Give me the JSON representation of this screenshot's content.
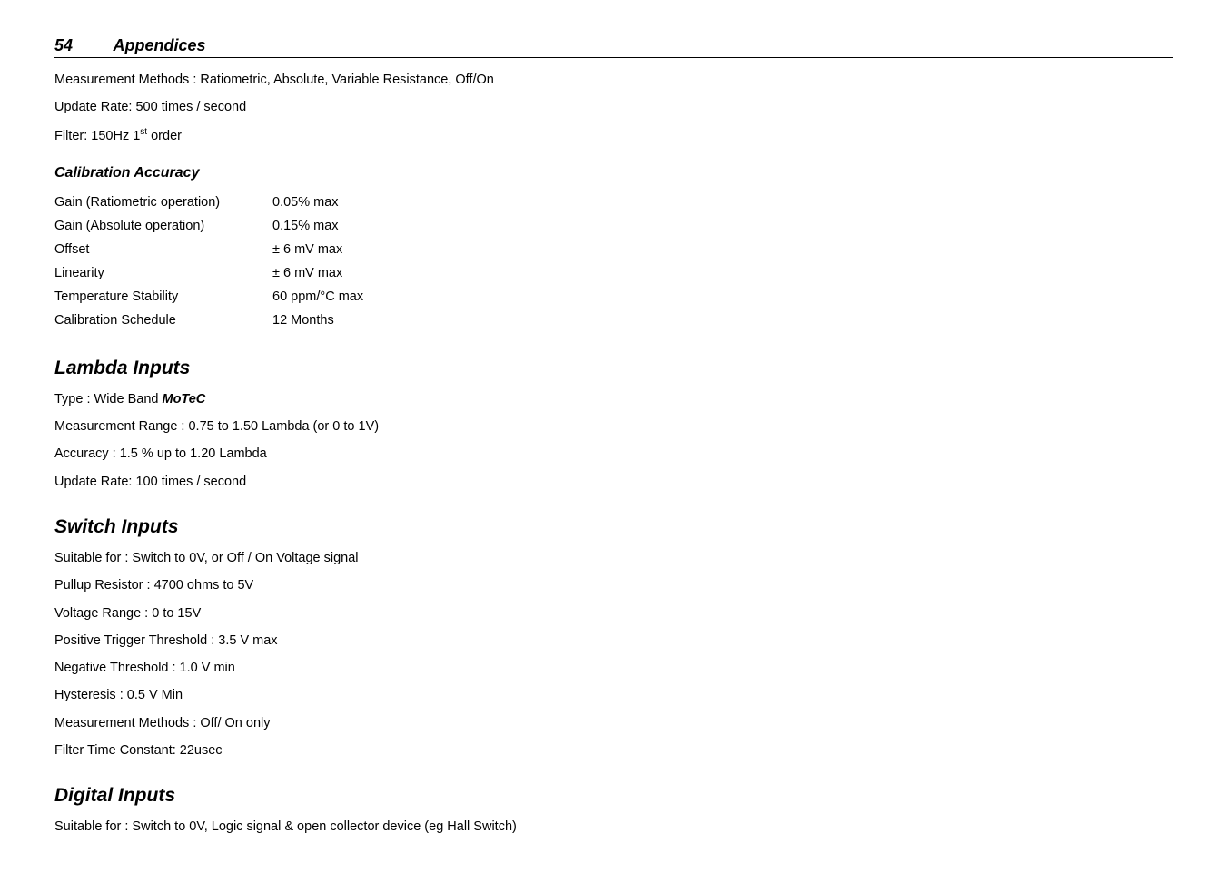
{
  "header": {
    "page_number": "54",
    "section_title": "Appendices"
  },
  "intro": {
    "measurement_methods": "Measurement Methods : Ratiometric, Absolute, Variable Resistance, Off/On",
    "update_rate": "Update Rate: 500 times / second",
    "filter_prefix": "Filter: 150Hz 1",
    "filter_sup": "st",
    "filter_suffix": " order"
  },
  "calibration": {
    "heading": "Calibration Accuracy",
    "rows": [
      {
        "label": "Gain (Ratiometric operation)",
        "value": "0.05% max"
      },
      {
        "label": "Gain (Absolute operation)",
        "value": "0.15% max"
      },
      {
        "label": "Offset",
        "value": "± 6 mV max"
      },
      {
        "label": "Linearity",
        "value": "± 6 mV max"
      },
      {
        "label": "Temperature Stability",
        "value": "60 ppm/°C max"
      },
      {
        "label": "Calibration Schedule",
        "value": "12 Months"
      }
    ]
  },
  "lambda": {
    "heading": "Lambda Inputs",
    "type_prefix": "Type : Wide Band ",
    "brand": "MoTeC",
    "range": "Measurement Range : 0.75 to 1.50 Lambda (or 0 to 1V)",
    "accuracy": "Accuracy : 1.5 % up to 1.20 Lambda",
    "update_rate": "Update Rate: 100 times / second"
  },
  "switch": {
    "heading": "Switch Inputs",
    "lines": [
      "Suitable for : Switch to 0V, or Off / On Voltage signal",
      "Pullup Resistor : 4700 ohms to 5V",
      "Voltage Range : 0 to 15V",
      "Positive Trigger Threshold : 3.5 V max",
      "Negative Threshold : 1.0 V min",
      "Hysteresis : 0.5 V Min",
      "Measurement Methods : Off/ On only",
      "Filter Time Constant: 22usec"
    ]
  },
  "digital": {
    "heading": "Digital Inputs",
    "line": "Suitable for : Switch to 0V, Logic signal & open collector device (eg Hall Switch)"
  }
}
